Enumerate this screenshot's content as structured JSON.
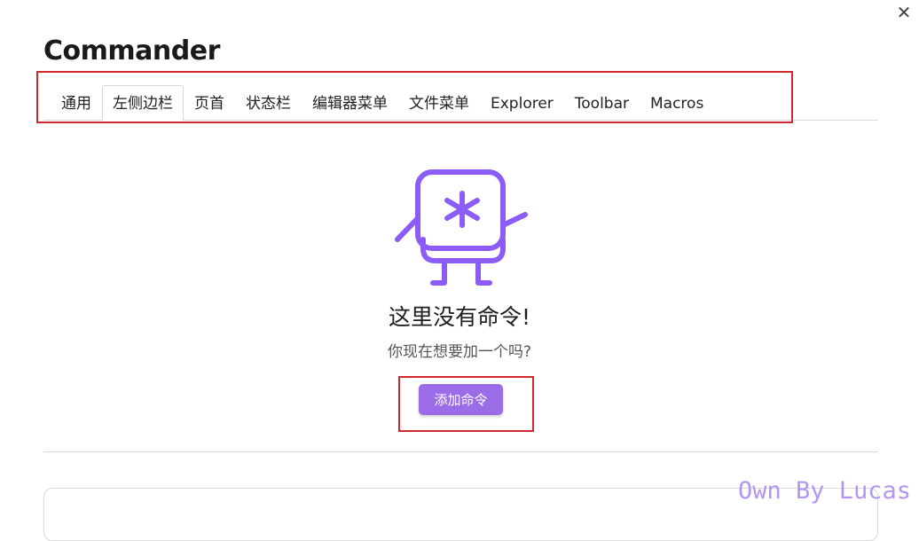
{
  "modal": {
    "close_icon": "✕"
  },
  "page": {
    "title": "Commander"
  },
  "tabs": [
    {
      "label": "通用",
      "active": false
    },
    {
      "label": "左侧边栏",
      "active": true
    },
    {
      "label": "页首",
      "active": false
    },
    {
      "label": "状态栏",
      "active": false
    },
    {
      "label": "编辑器菜单",
      "active": false
    },
    {
      "label": "文件菜单",
      "active": false
    },
    {
      "label": "Explorer",
      "active": false
    },
    {
      "label": "Toolbar",
      "active": false
    },
    {
      "label": "Macros",
      "active": false
    }
  ],
  "empty_state": {
    "illustration": "commander-mascot-icon",
    "title": "这里没有命令!",
    "subtitle": "你现在想要加一个吗?",
    "add_button_label": "添加命令"
  },
  "watermark": "Own By Lucas",
  "colors": {
    "accent": "#9a6ce8",
    "mascot": "#8b5cf6",
    "highlight_box": "#d42a2f",
    "watermark": "#b395f3"
  }
}
